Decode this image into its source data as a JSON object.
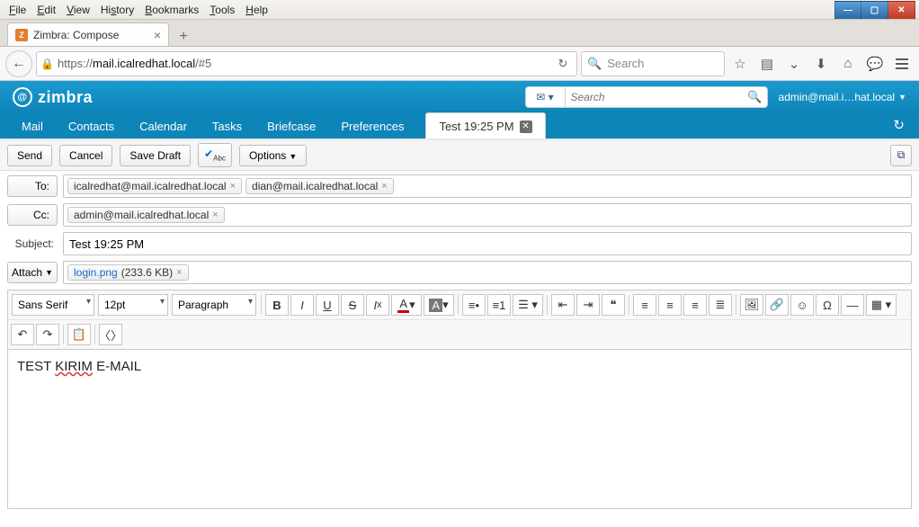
{
  "browser": {
    "menu": [
      "File",
      "Edit",
      "View",
      "History",
      "Bookmarks",
      "Tools",
      "Help"
    ],
    "tab_title": "Zimbra: Compose",
    "url_pre": "https://",
    "url_host": "mail.icalredhat.local",
    "url_path": "/#5",
    "search_placeholder": "Search"
  },
  "zimbra": {
    "brand": "zimbra",
    "search_placeholder": "Search",
    "user": "admin@mail.i…hat.local",
    "tabs": {
      "mail": "Mail",
      "contacts": "Contacts",
      "calendar": "Calendar",
      "tasks": "Tasks",
      "briefcase": "Briefcase",
      "prefs": "Preferences",
      "docname": "Test 19:25 PM"
    }
  },
  "toolbar": {
    "send": "Send",
    "cancel": "Cancel",
    "savedraft": "Save Draft",
    "options": "Options"
  },
  "compose": {
    "to_label": "To:",
    "cc_label": "Cc:",
    "subject_label": "Subject:",
    "attach_label": "Attach",
    "subject_value": "Test 19:25 PM",
    "to": [
      "icalredhat@mail.icalredhat.local",
      "dian@mail.icalredhat.local"
    ],
    "cc": [
      "admin@mail.icalredhat.local"
    ],
    "attachment_name": "login.png",
    "attachment_size": "(233.6 KB)"
  },
  "editor": {
    "font": "Sans Serif",
    "size": "12pt",
    "style": "Paragraph",
    "body_plain": "TEST ",
    "body_red": "KIRIM",
    "body_tail": " E-MAIL"
  }
}
